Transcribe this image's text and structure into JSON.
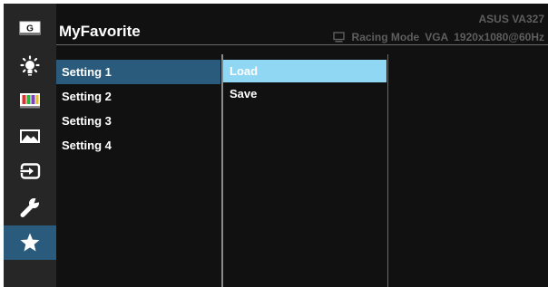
{
  "osd": {
    "title": "MyFavorite",
    "model": "ASUS  VA327",
    "status": {
      "mode": "Racing Mode",
      "input": "VGA",
      "resolution": "1920x1080@60Hz"
    }
  },
  "sidebar": {
    "items": [
      {
        "icon": "splendid-g-icon",
        "label": "G"
      },
      {
        "icon": "blue-light-filter-icon"
      },
      {
        "icon": "color-icon"
      },
      {
        "icon": "image-icon"
      },
      {
        "icon": "input-select-icon"
      },
      {
        "icon": "system-setup-icon"
      },
      {
        "icon": "star-icon",
        "active": true
      }
    ]
  },
  "settings": {
    "items": [
      "Setting 1",
      "Setting 2",
      "Setting 3",
      "Setting 4"
    ],
    "selected": "Setting 1"
  },
  "actions": {
    "items": [
      "Load",
      "Save"
    ],
    "selected": "Load"
  },
  "colors": {
    "background": "#111111",
    "sidebar": "#262626",
    "selected_blue": "#2b5b7c",
    "highlight_cyan": "#8fd7f3",
    "muted_text": "#5e5e5e"
  }
}
